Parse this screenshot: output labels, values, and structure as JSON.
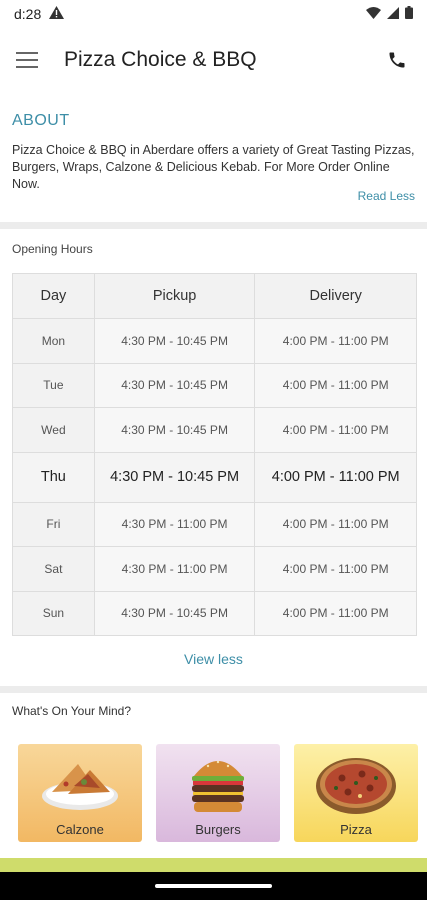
{
  "status_bar": {
    "time": "d:28",
    "icons": [
      "alert-icon",
      "wifi-icon",
      "signal-icon",
      "battery-icon"
    ]
  },
  "app_bar": {
    "title": "Pizza Choice & BBQ",
    "menu_icon": "hamburger-menu-icon",
    "phone_icon": "phone-icon"
  },
  "about": {
    "title": "ABOUT",
    "text": "Pizza Choice & BBQ in Aberdare offers a variety of Great Tasting Pizzas, Burgers, Wraps, Calzone & Delicious Kebab. For More Order Online Now.",
    "read_less": "Read Less"
  },
  "opening_hours": {
    "label": "Opening Hours",
    "headers": [
      "Day",
      "Pickup",
      "Delivery"
    ],
    "rows": [
      {
        "day": "Mon",
        "pickup": "4:30 PM - 10:45 PM",
        "delivery": "4:00 PM - 11:00 PM"
      },
      {
        "day": "Tue",
        "pickup": "4:30 PM - 10:45 PM",
        "delivery": "4:00 PM - 11:00 PM"
      },
      {
        "day": "Wed",
        "pickup": "4:30 PM - 10:45 PM",
        "delivery": "4:00 PM - 11:00 PM"
      },
      {
        "day": "Thu",
        "pickup": "4:30 PM - 10:45 PM",
        "delivery": "4:00 PM - 11:00 PM",
        "today": true
      },
      {
        "day": "Fri",
        "pickup": "4:30 PM - 11:00 PM",
        "delivery": "4:00 PM - 11:00 PM"
      },
      {
        "day": "Sat",
        "pickup": "4:30 PM - 11:00 PM",
        "delivery": "4:00 PM - 11:00 PM"
      },
      {
        "day": "Sun",
        "pickup": "4:30 PM - 10:45 PM",
        "delivery": "4:00 PM - 11:00 PM"
      }
    ],
    "view_less": "View less"
  },
  "whats_on_your_mind": {
    "label": "What's On Your Mind?",
    "categories": [
      {
        "label": "Calzone",
        "icon": "calzone-image"
      },
      {
        "label": "Burgers",
        "icon": "burger-image"
      },
      {
        "label": "Pizza",
        "icon": "pizza-image"
      }
    ]
  },
  "colors": {
    "accent": "#3d8ea7",
    "bottom_accent": "#cfdc6b"
  }
}
